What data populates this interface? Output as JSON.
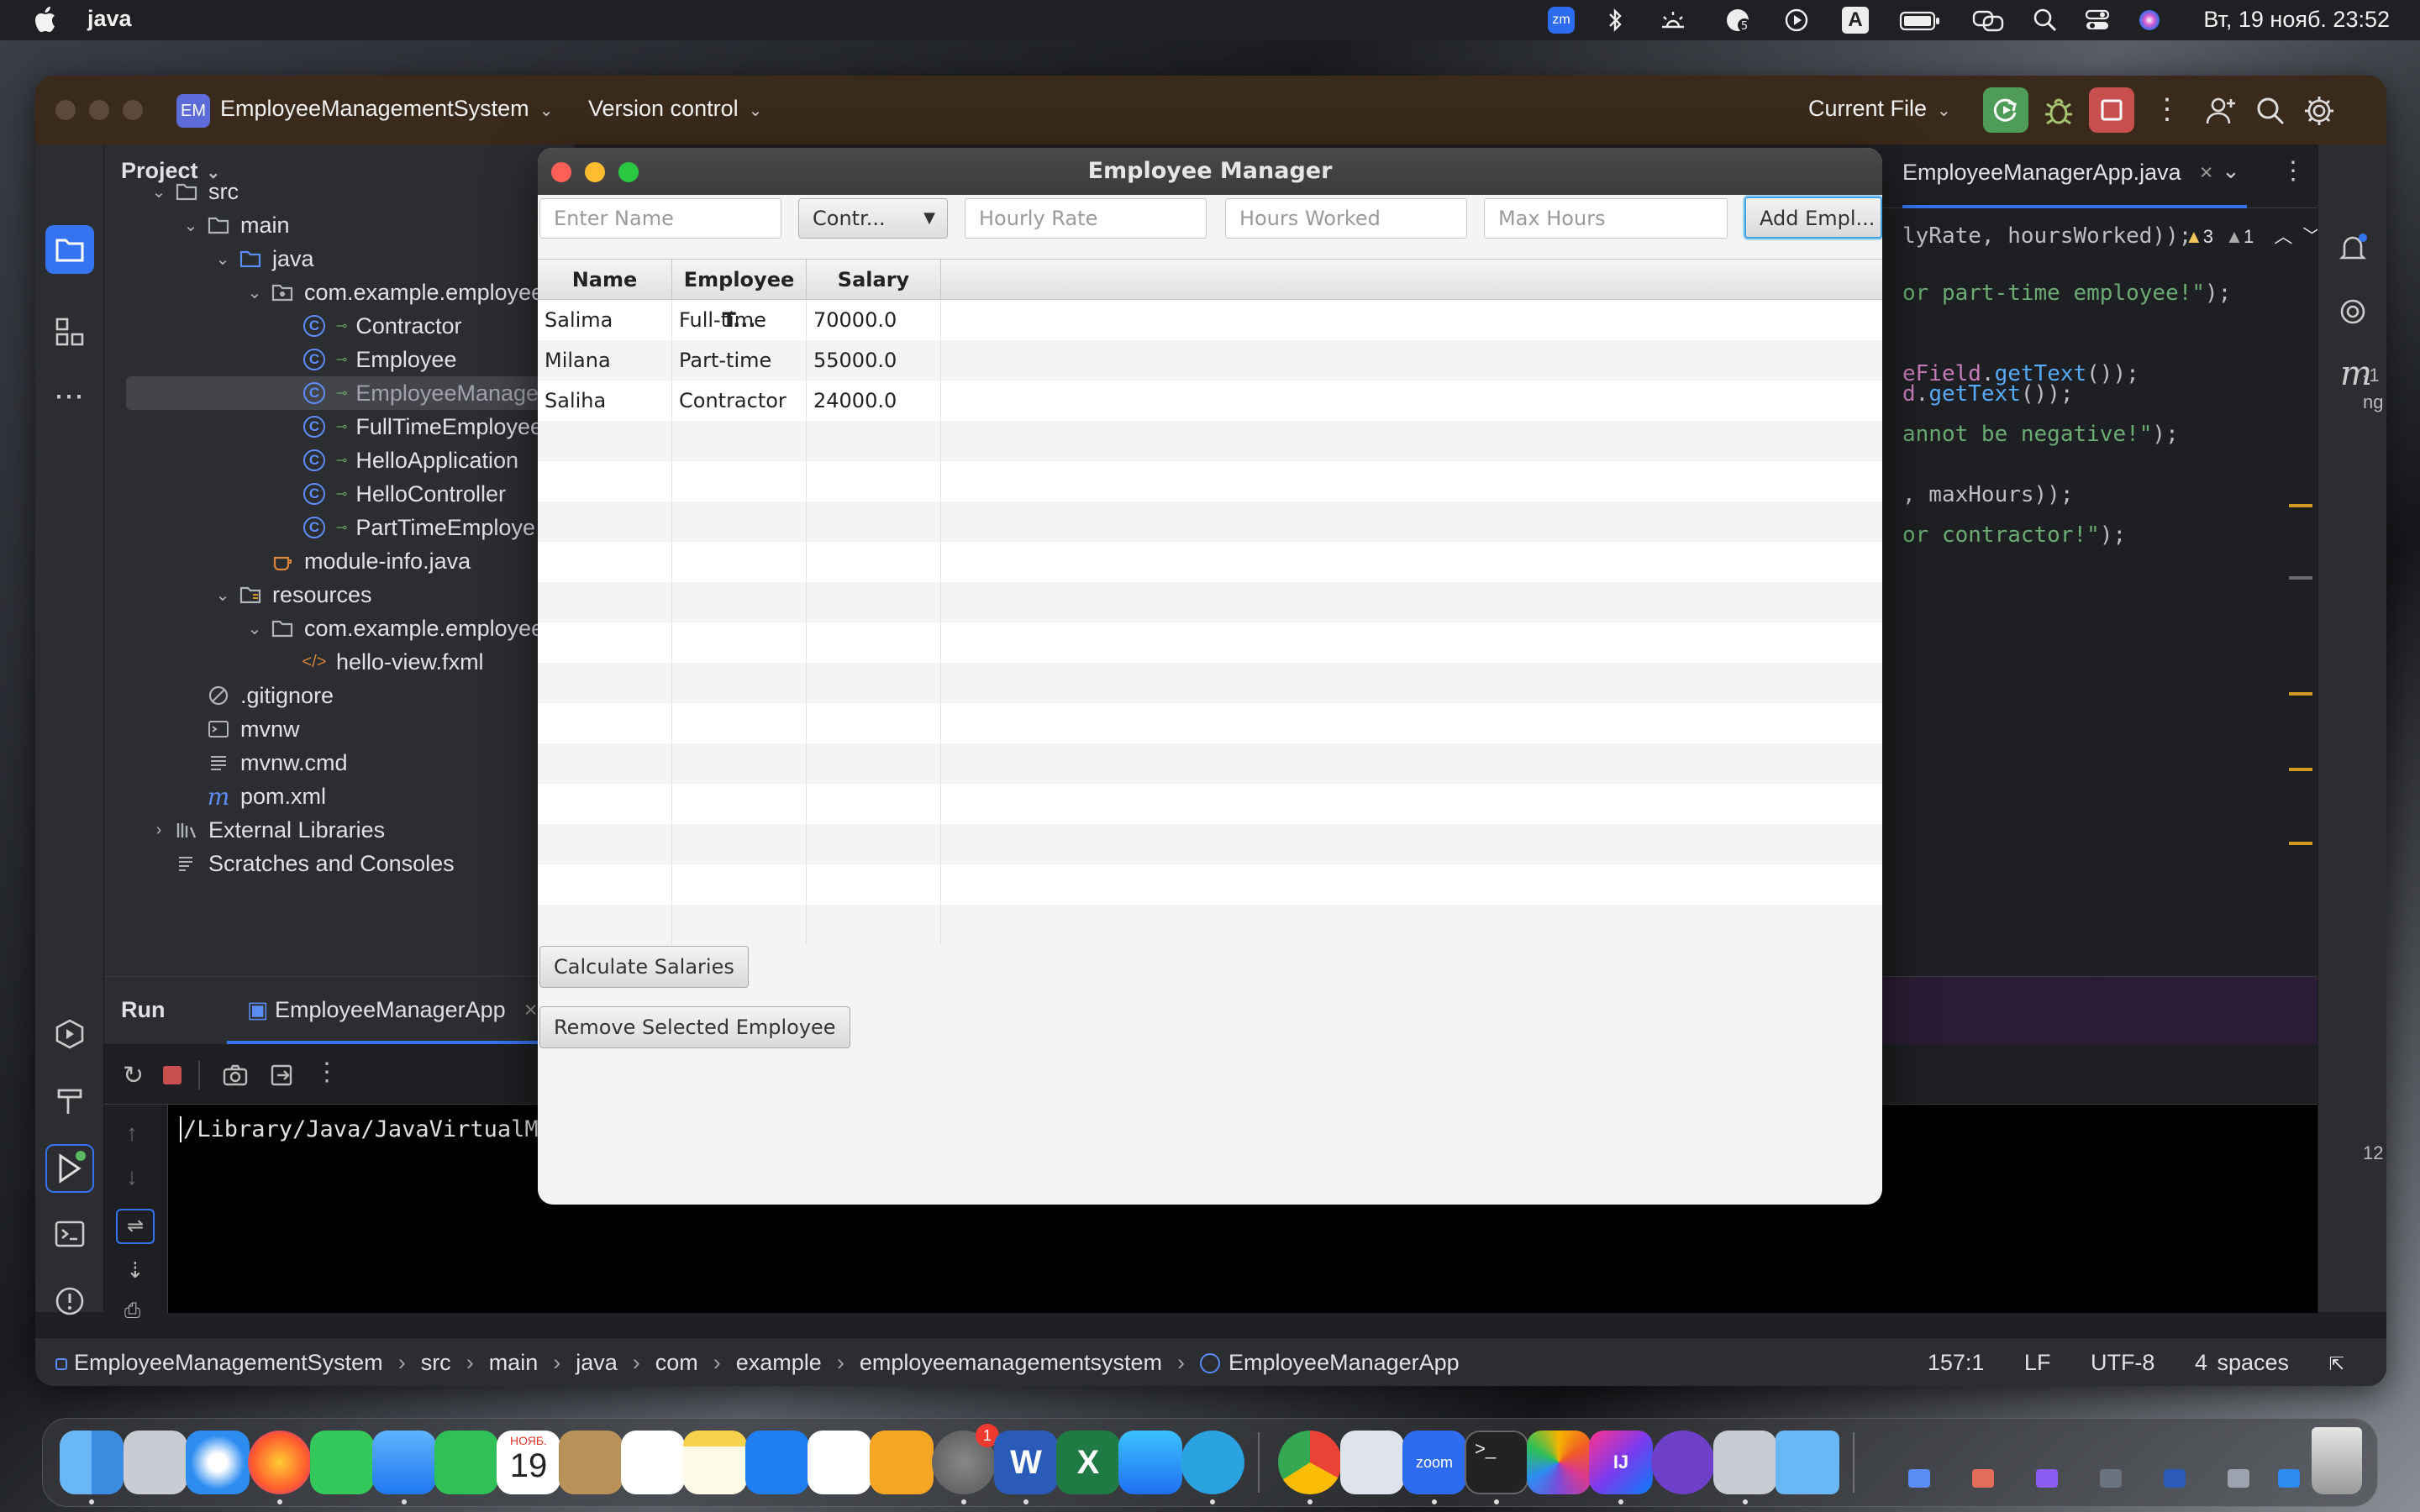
{
  "menubar": {
    "app_name": "java",
    "clock": "Вт, 19 нояб.  23:52",
    "zoom_badge": "zm",
    "cloud_count": "5",
    "input_letter": "A"
  },
  "ide": {
    "project_badge": "EM",
    "project_name": "EmployeeManagementSystem",
    "version_control": "Version control",
    "run_config": "Current File",
    "panel_title": "Project",
    "tree": [
      {
        "label": "src",
        "level": 1,
        "kind": "folder",
        "open": true
      },
      {
        "label": "main",
        "level": 2,
        "kind": "folder",
        "open": true
      },
      {
        "label": "java",
        "level": 3,
        "kind": "folder-blue",
        "open": true
      },
      {
        "label": "com.example.employee",
        "level": 4,
        "kind": "package",
        "open": true
      },
      {
        "label": "Contractor",
        "level": 5,
        "kind": "class"
      },
      {
        "label": "Employee",
        "level": 5,
        "kind": "class"
      },
      {
        "label": "EmployeeManage",
        "level": 5,
        "kind": "class-run",
        "selected": true
      },
      {
        "label": "FullTimeEmployee",
        "level": 5,
        "kind": "class"
      },
      {
        "label": "HelloApplication",
        "level": 5,
        "kind": "class-run"
      },
      {
        "label": "HelloController",
        "level": 5,
        "kind": "class"
      },
      {
        "label": "PartTimeEmploye",
        "level": 5,
        "kind": "class"
      },
      {
        "label": "module-info.java",
        "level": 4,
        "kind": "java"
      },
      {
        "label": "resources",
        "level": 3,
        "kind": "folder-res",
        "open": true
      },
      {
        "label": "com.example.employee",
        "level": 4,
        "kind": "folder",
        "open": true
      },
      {
        "label": "hello-view.fxml",
        "level": 5,
        "kind": "fxml"
      },
      {
        "label": ".gitignore",
        "level": 2,
        "kind": "ignore"
      },
      {
        "label": "mvnw",
        "level": 2,
        "kind": "terminal"
      },
      {
        "label": "mvnw.cmd",
        "level": 2,
        "kind": "text"
      },
      {
        "label": "pom.xml",
        "level": 2,
        "kind": "maven"
      },
      {
        "label": "External Libraries",
        "level": 1,
        "kind": "libs",
        "closed": true
      },
      {
        "label": "Scratches and Consoles",
        "level": 1,
        "kind": "scratch"
      }
    ],
    "editor_tab": "EmployeeManagerApp.java",
    "warnings": "3",
    "weak_warnings": "1",
    "code_lines": [
      {
        "parts": [
          {
            "t": "lyRate, hoursWorked));",
            "c": ""
          }
        ]
      },
      {
        "parts": [
          {
            "t": "or part-time employee!\"",
            "c": "str"
          },
          {
            "t": ");",
            "c": ""
          }
        ]
      },
      {
        "parts": [
          {
            "t": "eField",
            "c": "purp"
          },
          {
            "t": ".",
            "c": ""
          },
          {
            "t": "getText",
            "c": "fn"
          },
          {
            "t": "());",
            "c": ""
          }
        ]
      },
      {
        "parts": [
          {
            "t": "d",
            "c": "purp"
          },
          {
            "t": ".",
            "c": ""
          },
          {
            "t": "getText",
            "c": "fn"
          },
          {
            "t": "());",
            "c": ""
          }
        ]
      },
      {
        "parts": [
          {
            "t": "annot be negative!\"",
            "c": "str"
          },
          {
            "t": ");",
            "c": ""
          }
        ]
      },
      {
        "parts": [
          {
            "t": ", maxHours));",
            "c": ""
          }
        ]
      },
      {
        "parts": [
          {
            "t": "or contractor!\"",
            "c": "str"
          },
          {
            "t": ");",
            "c": ""
          }
        ]
      }
    ],
    "right_edge_text": [
      "-1",
      "ng",
      "12"
    ],
    "run_label": "Run",
    "run_tab": "EmployeeManagerApp",
    "console_line": "/Library/Java/JavaVirtualMa",
    "breadcrumb": [
      "EmployeeManagementSystem",
      "src",
      "main",
      "java",
      "com",
      "example",
      "employeemanagementsystem",
      "EmployeeManagerApp"
    ],
    "status": {
      "position": "157:1",
      "line_sep": "LF",
      "encoding": "UTF-8",
      "indent": "4 spaces"
    }
  },
  "dialog": {
    "title": "Employee Manager",
    "name_placeholder": "Enter Name",
    "type_selected": "Contr...",
    "rate_placeholder": "Hourly Rate",
    "hours_placeholder": "Hours Worked",
    "max_placeholder": "Max Hours",
    "add_button": "Add Empl...",
    "table": {
      "columns": [
        "Name",
        "Employee T...",
        "Salary"
      ],
      "rows": [
        [
          "Salima",
          "Full-time",
          "70000.0"
        ],
        [
          "Milana",
          "Part-time",
          "55000.0"
        ],
        [
          "Saliha",
          "Contractor",
          "24000.0"
        ]
      ]
    },
    "calc_button": "Calculate Salaries",
    "remove_button": "Remove Selected Employee"
  },
  "dock": {
    "calendar_month": "НОЯБ.",
    "calendar_day": "19",
    "settings_badge": "1",
    "word_letter": "W",
    "excel_letter": "X",
    "zoom_label": "zoom",
    "intellij_label": "IJ"
  }
}
